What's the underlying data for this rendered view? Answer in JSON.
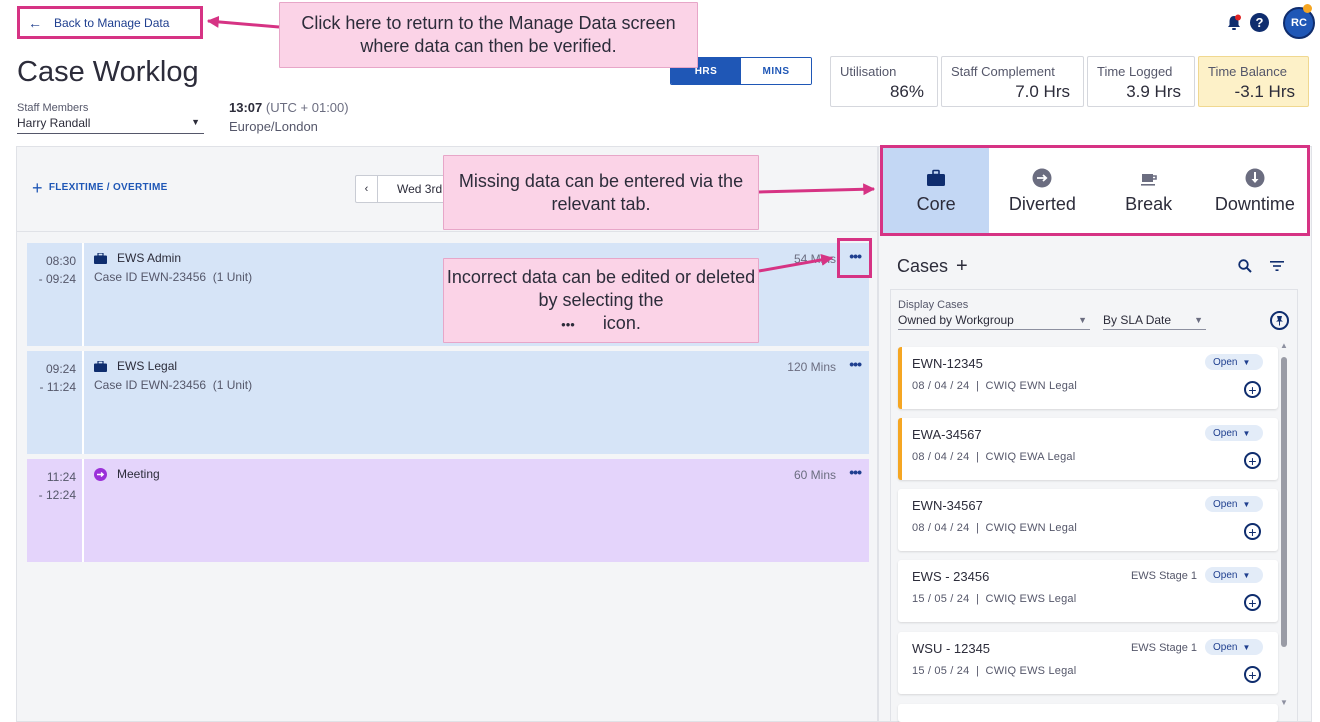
{
  "header": {
    "back_label": "Back to Manage Data",
    "title": "Case Worklog",
    "staff_label": "Staff Members",
    "staff_value": "Harry Randall",
    "time": "13:07",
    "utc": "(UTC + 01:00)",
    "timezone": "Europe/London",
    "toggle": {
      "hrs": "HRS",
      "mins": "MINS",
      "active": "HRS"
    },
    "avatar": "RC",
    "help": "?"
  },
  "stats": [
    {
      "label": "Utilisation",
      "value": "86%"
    },
    {
      "label": "Staff Complement",
      "value": "7.0 Hrs"
    },
    {
      "label": "Time Logged",
      "value": "3.9 Hrs"
    },
    {
      "label": "Time Balance",
      "value": "-3.1 Hrs"
    }
  ],
  "toolbar": {
    "flexi_label": "FLEXITIME / OVERTIME",
    "date_label": "Wed 3rd"
  },
  "entries": [
    {
      "start": "08:30",
      "end": "- 09:24",
      "title": "EWS Admin",
      "case": "Case ID EWN-23456",
      "units": "(1 Unit)",
      "mins": "54 Mins",
      "type": "core"
    },
    {
      "start": "09:24",
      "end": "- 11:24",
      "title": "EWS Legal",
      "case": "Case ID EWN-23456",
      "units": "(1 Unit)",
      "mins": "120 Mins",
      "type": "core"
    },
    {
      "start": "11:24",
      "end": "- 12:24",
      "title": "Meeting",
      "mins": "60 Mins",
      "type": "meeting"
    }
  ],
  "tabs": [
    {
      "label": "Core",
      "icon": "briefcase-icon",
      "active": true
    },
    {
      "label": "Diverted",
      "icon": "arrow-circle-icon",
      "active": false
    },
    {
      "label": "Break",
      "icon": "coffee-icon",
      "active": false
    },
    {
      "label": "Downtime",
      "icon": "alert-circle-icon",
      "active": false
    }
  ],
  "cases": {
    "title": "Cases",
    "display_label": "Display Cases",
    "owner_filter": "Owned by Workgroup",
    "sort": "By SLA Date",
    "items": [
      {
        "id": "EWN-12345",
        "date": "08 / 04 / 24",
        "group": "CWIQ EWN Legal",
        "stage": "",
        "status": "Open",
        "flag": true
      },
      {
        "id": "EWA-34567",
        "date": "08 / 04 / 24",
        "group": "CWIQ EWA Legal",
        "stage": "",
        "status": "Open",
        "flag": true
      },
      {
        "id": "EWN-34567",
        "date": "08 / 04 / 24",
        "group": "CWIQ EWN Legal",
        "stage": "",
        "status": "Open",
        "flag": false
      },
      {
        "id": "EWS - 23456",
        "date": "15 / 05 / 24",
        "group": "CWIQ EWS Legal",
        "stage": "EWS Stage 1",
        "status": "Open",
        "flag": false
      },
      {
        "id": "WSU - 12345",
        "date": "15 / 05 / 24",
        "group": "CWIQ EWS Legal",
        "stage": "EWS Stage 1",
        "status": "Open",
        "flag": false
      }
    ]
  },
  "callouts": {
    "back": "Click here to return to the Manage Data screen where data can then be verified.",
    "tabs": "Missing data can be entered via the relevant tab.",
    "edit_a": "Incorrect data can be edited or deleted by selecting the",
    "edit_dots": "•••",
    "edit_b": "icon."
  },
  "colors": {
    "accent": "#1f57b6",
    "highlight": "#d63384",
    "callout_bg": "#fbd3e7",
    "core_bg": "#d6e4f7",
    "meeting_bg": "#e4d4fb",
    "warning_bg": "#fdf1c8",
    "flag": "#f5a623"
  }
}
